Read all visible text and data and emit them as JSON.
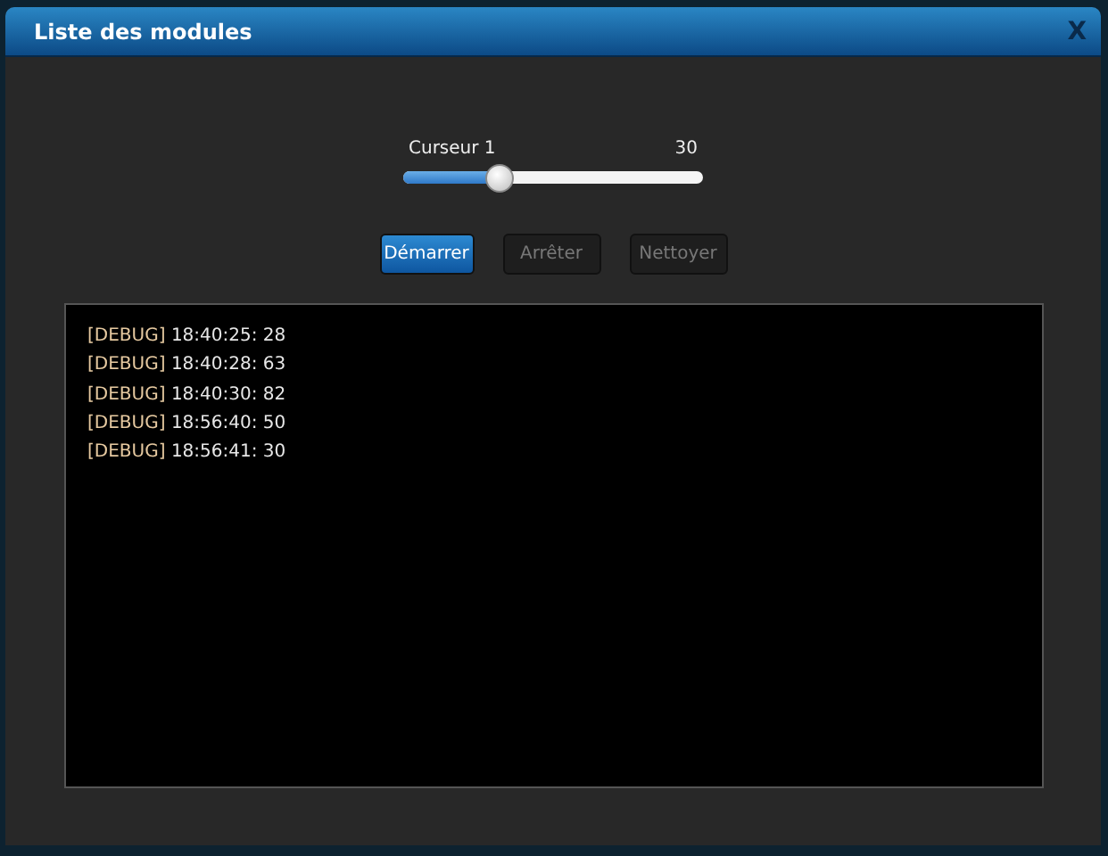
{
  "window": {
    "title": "Liste des modules",
    "close": "X"
  },
  "slider": {
    "label": "Curseur 1",
    "reading": "30",
    "level": 0.32
  },
  "buttons": [
    {
      "label": "Démarrer",
      "disabled": false
    },
    {
      "label": "Arrêter",
      "disabled": true
    },
    {
      "label": "Nettoyer",
      "disabled": true
    }
  ],
  "log": [
    {
      "tag": "[DEBUG]",
      "message": "18:40:25: 28"
    },
    {
      "tag": "[DEBUG]",
      "message": "18:40:28: 63"
    },
    {
      "tag": "[DEBUG]",
      "message": "18:40:30: 82"
    },
    {
      "tag": "[DEBUG]",
      "message": "18:56:40: 50"
    },
    {
      "tag": "[DEBUG]",
      "message": "18:56:41: 30"
    }
  ]
}
